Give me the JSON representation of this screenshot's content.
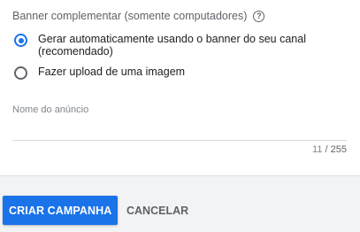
{
  "banner_section": {
    "title": "Banner complementar (somente computadores)",
    "help_icon_glyph": "?",
    "help_icon": "help-circle-icon",
    "options": [
      {
        "label": "Gerar automaticamente usando o banner do seu canal (recomendado)",
        "selected": true
      },
      {
        "label": "Fazer upload de uma imagem",
        "selected": false
      }
    ]
  },
  "ad_name_field": {
    "label": "Nome do anúncio",
    "value": "",
    "count_used": "11",
    "count_sep": " / ",
    "count_max": "255"
  },
  "footer": {
    "create_button": "CRIAR CAMPANHA",
    "cancel_button": "CANCELAR"
  },
  "colors": {
    "accent": "#1a73e8",
    "footer_bg": "#f1f3f4"
  }
}
